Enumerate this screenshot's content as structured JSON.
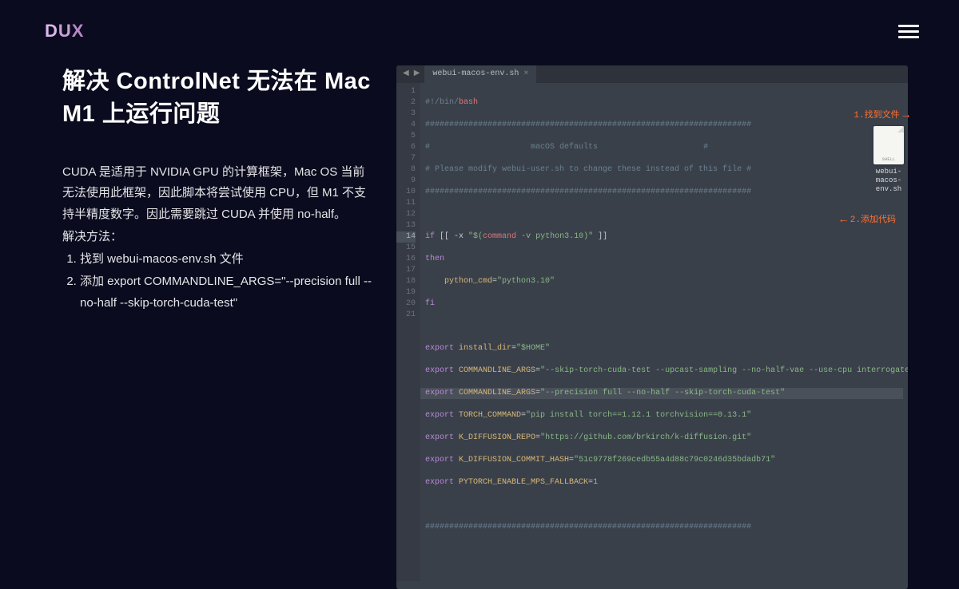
{
  "logo": {
    "d": "D",
    "u": "U",
    "x": "X"
  },
  "title": "解决 ControlNet 无法在 Mac M1 上运行问题",
  "body": "CUDA 是适用于 NVIDIA GPU 的计算框架，Mac OS 当前无法使用此框架，因此脚本将尝试使用 CPU，但 M1 不支持半精度数字。因此需要跳过 CUDA 并使用 no-half。",
  "method_label": "解决方法：",
  "step1": "找到 webui-macos-env.sh 文件",
  "step2": "添加 export COMMANDLINE_ARGS=\"--precision full --no-half --skip-torch-cuda-test\"",
  "tab_name": "webui-macos-env.sh",
  "ann1": "1.找到文件",
  "ann2": "2.添加代码",
  "file_name": "webui-macos-env.sh",
  "code_lines": {
    "l1": "#!/bin/",
    "l1b": "bash",
    "l2": "####################################################################",
    "l3a": "#                     ",
    "l3b": "macOS defaults",
    "l3c": "                      #",
    "l4": "# Please modify webui-user.sh to change these instead of this file #",
    "l5": "####################################################################",
    "l7a": "if",
    "l7b": " [[ -x ",
    "l7c": "\"$(",
    "l7d": "command",
    "l7e": " -v python3.10)\"",
    "l7f": " ]]",
    "l8": "then",
    "l9a": "    ",
    "l9b": "python_cmd",
    "l9c": "=",
    "l9d": "\"python3.10\"",
    "l10": "fi",
    "l12a": "export",
    "l12b": " install_dir",
    "l12c": "=",
    "l12d": "\"$HOME\"",
    "l13a": "export",
    "l13b": " COMMANDLINE_ARGS",
    "l13c": "=",
    "l13d": "\"--skip-torch-cuda-test --upcast-sampling --no-half-vae --use-cpu interrogate\"",
    "l14a": "export",
    "l14b": " COMMANDLINE_ARGS",
    "l14c": "=",
    "l14d": "\"--precision full --no-half --skip-torch-cuda-test\"",
    "l15a": "export",
    "l15b": " TORCH_COMMAND",
    "l15c": "=",
    "l15d": "\"pip install torch==1.12.1 torchvision==0.13.1\"",
    "l16a": "export",
    "l16b": " K_DIFFUSION_REPO",
    "l16c": "=",
    "l16d": "\"https://github.com/brkirch/k-diffusion.git\"",
    "l17a": "export",
    "l17b": " K_DIFFUSION_COMMIT_HASH",
    "l17c": "=",
    "l17d": "\"51c9778f269cedb55a4d88c79c0246d35bdadb71\"",
    "l18a": "export",
    "l18b": " PYTORCH_ENABLE_MPS_FALLBACK",
    "l18c": "=",
    "l18d": "1",
    "l20": "####################################################################"
  }
}
